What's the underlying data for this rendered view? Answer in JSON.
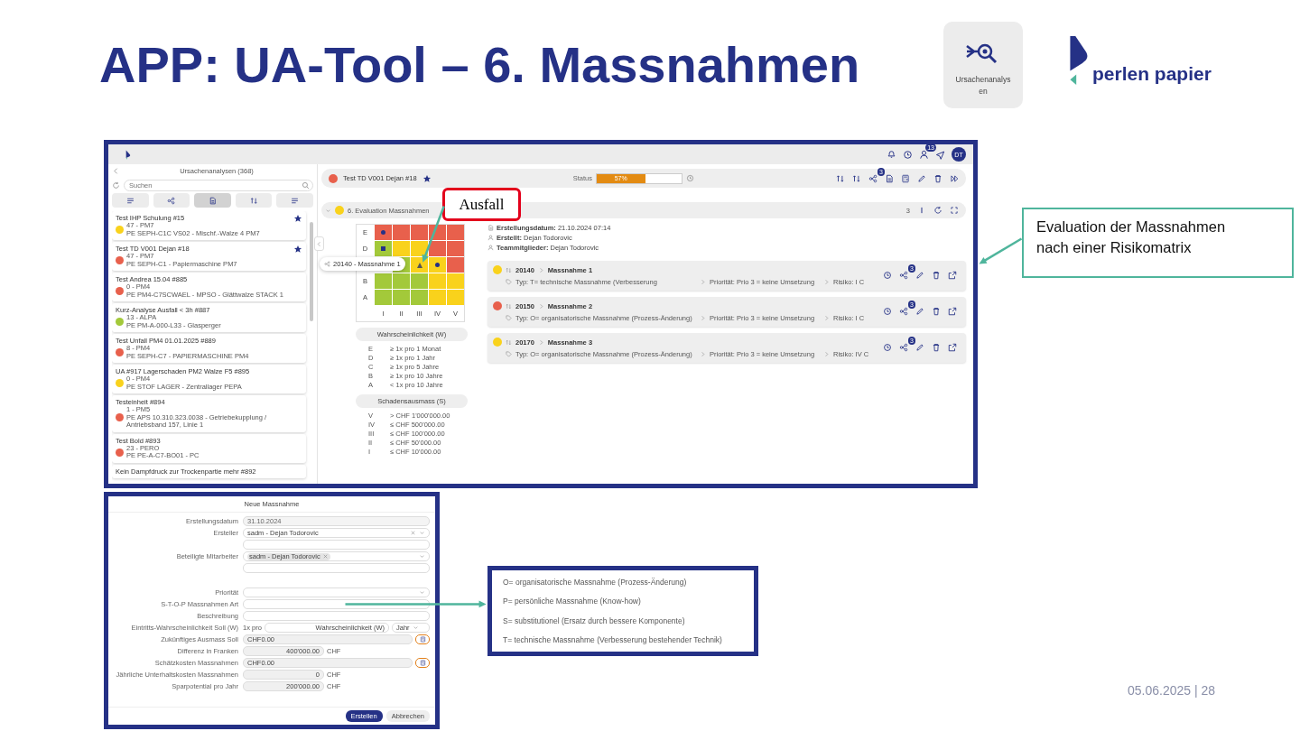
{
  "title": "APP: UA-Tool – 6. Massnahmen",
  "app_tile": {
    "label": "Ursachenanalysen"
  },
  "logo": {
    "text": "perlen papier"
  },
  "main_screenshot": {
    "top_bar": {
      "badge": "13",
      "avatar": "DT"
    },
    "list_panel": {
      "title": "Ursachenanalysen (368)",
      "search_placeholder": "Suchen",
      "filters": [
        {
          "selected": false
        },
        {
          "selected": false
        },
        {
          "selected": true
        },
        {
          "selected": false
        },
        {
          "selected": false
        }
      ],
      "items": [
        {
          "title": "Test IHP Schulung",
          "number": "#15",
          "location": "47 - PM7",
          "equipment": "PE SEPH-C1C VS02 - Mischf.-Walze 4 PM7",
          "color": "#f9d21c",
          "starred": true
        },
        {
          "title": "Test TD V001 Dejan",
          "number": "#18",
          "location": "47 - PM7",
          "equipment": "PE SEPH-C1 - Papiermaschine PM7",
          "color": "#e8604c",
          "starred": true
        },
        {
          "title": "Test Andrea 15.04",
          "number": "#885",
          "location": "0 - PM4",
          "equipment": "PE PM4-C7SCWAEL - MPSO - Glättwalze STACK 1",
          "color": "#e8604c",
          "starred": false
        },
        {
          "title": "Kurz-Analyse Ausfall < 3h",
          "number": "#887",
          "location": "13 - ALPA",
          "equipment": "PE PM-A-000-L33 - Glasperger",
          "color": "#a3c93a",
          "starred": false
        },
        {
          "title": "Test Unfall PM4 01.01.2025",
          "number": "#889",
          "location": "8 - PM4",
          "equipment": "PE SEPH-C7 - PAPIERMASCHINE PM4",
          "color": "#e8604c",
          "starred": false
        },
        {
          "title": "UA #917 Lagerschaden PM2 Walze F5",
          "number": "#895",
          "location": "0 - PM4",
          "equipment": "PE STOF LAGER - Zentrallager PEPA",
          "color": "#f9d21c",
          "starred": false
        },
        {
          "title": "Testeinheit",
          "number": "#894",
          "location": "1 - PM5",
          "equipment": "PE APS 10.310.323.0038 - Getriebekupplung / Antriebsband 157, Linie 1",
          "color": "#e8604c",
          "starred": false
        },
        {
          "title": "Test Bold",
          "number": "#893",
          "location": "23 - PERO",
          "equipment": "PE PE-A-C7-BO01 - PC",
          "color": "#e8604c",
          "starred": false
        },
        {
          "title": "Kein Dampfdruck zur Trockenpartie mehr",
          "number": "#892"
        }
      ]
    },
    "header": {
      "title": "Test TD V001 Dejan",
      "number": "#18",
      "color": "#e8604c",
      "starred": true,
      "status_label": "Status",
      "progress": {
        "level": 0.57,
        "text": "57%"
      },
      "badge": "3"
    },
    "section": {
      "title": "6. Evaluation Massnahmen",
      "color": "#f9d21c",
      "count": "3"
    },
    "matrix": {
      "column_labels": [
        "I",
        "II",
        "III",
        "IV",
        "V"
      ],
      "rows": [
        {
          "label": "E",
          "cells": [
            {
              "color": "#e8604c",
              "kind": "dot"
            },
            {
              "color": "#e8604c",
              "kind": "plain"
            },
            {
              "color": "#e8604c",
              "kind": "plain"
            },
            {
              "color": "#e8604c",
              "kind": "plain"
            },
            {
              "color": "#e8604c",
              "kind": "plain"
            }
          ]
        },
        {
          "label": "D",
          "cells": [
            {
              "color": "#a3c93a",
              "kind": "square"
            },
            {
              "color": "#f9d21c",
              "kind": "plain"
            },
            {
              "color": "#f9d21c",
              "kind": "plain"
            },
            {
              "color": "#e8604c",
              "kind": "plain"
            },
            {
              "color": "#e8604c",
              "kind": "plain"
            }
          ]
        },
        {
          "cells": [
            {
              "kind": "plain"
            },
            {
              "color": "#a3c93a",
              "kind": "plain"
            },
            {
              "color": "#f9d21c",
              "kind": "triangle"
            },
            {
              "color": "#f9d21c",
              "kind": "dot"
            },
            {
              "color": "#e8604c",
              "kind": "plain"
            }
          ]
        },
        {
          "label": "B",
          "cells": [
            {
              "color": "#a3c93a",
              "kind": "plain"
            },
            {
              "color": "#a3c93a",
              "kind": "plain"
            },
            {
              "color": "#a3c93a",
              "kind": "plain"
            },
            {
              "color": "#f9d21c",
              "kind": "plain"
            },
            {
              "color": "#f9d21c",
              "kind": "plain"
            }
          ]
        },
        {
          "label": "A",
          "cells": [
            {
              "color": "#a3c93a",
              "kind": "plain"
            },
            {
              "color": "#a3c93a",
              "kind": "plain"
            },
            {
              "color": "#a3c93a",
              "kind": "plain"
            },
            {
              "color": "#f9d21c",
              "kind": "plain"
            },
            {
              "color": "#f9d21c",
              "kind": "plain"
            }
          ]
        }
      ],
      "tooltip": "20140 - Massnahme 1"
    },
    "probability_legend": {
      "title": "Wahrscheinlichkeit (W)",
      "entries": [
        {
          "key": "E",
          "text": "≥ 1x pro 1 Monat"
        },
        {
          "key": "D",
          "text": "≥ 1x pro 1 Jahr"
        },
        {
          "key": "C",
          "text": "≥ 1x pro 5 Jahre"
        },
        {
          "key": "B",
          "text": "≥ 1x pro 10 Jahre"
        },
        {
          "key": "A",
          "text": "< 1x pro 10 Jahre"
        }
      ]
    },
    "damage_legend": {
      "title": "Schadensausmass (S)",
      "entries": [
        {
          "key": "V",
          "text": "> CHF 1'000'000.00"
        },
        {
          "key": "IV",
          "text": "≤ CHF 500'000.00"
        },
        {
          "key": "III",
          "text": "≤ CHF 100'000.00"
        },
        {
          "key": "II",
          "text": "≤ CHF 50'000.00"
        },
        {
          "key": "I",
          "text": "≤ CHF 10'000.00"
        }
      ]
    },
    "meta": [
      {
        "label": "Erstellungsdatum:",
        "value": "21.10.2024 07:14"
      },
      {
        "label": "Erstellt:",
        "value": "Dejan Todorovic"
      },
      {
        "label": "Teammitglieder:",
        "value": "Dejan Todorovic"
      }
    ],
    "measures": [
      {
        "id": "20140",
        "name": "Massnahme 1",
        "color": "#f9d21c",
        "type": "Typ: T= technische Massnahme (Verbesserung",
        "priority": "Priorität: Prio 3 = keine Umsetzung",
        "risk": "Risiko: I C",
        "badge": "3"
      },
      {
        "id": "20150",
        "name": "Massnahme 2",
        "color": "#e8604c",
        "type": "Typ: O= organisatorische Massnahme (Prozess-Änderung)",
        "priority": "Priorität: Prio 3 = keine Umsetzung",
        "risk": "Risiko: I C",
        "badge": "3"
      },
      {
        "id": "20170",
        "name": "Massnahme 3",
        "color": "#f9d21c",
        "type": "Typ: O= organisatorische Massnahme (Prozess-Änderung)",
        "priority": "Priorität: Prio 3 = keine Umsetzung",
        "risk": "Risiko: IV C",
        "badge": "3"
      }
    ]
  },
  "callout_failure": "Ausfall",
  "callout_text": "Evaluation der Massnahmen nach einer Risikomatrix",
  "form_screenshot": {
    "title": "Neue Massnahme",
    "rows": [
      {
        "kind": "text",
        "label": "Erstellungsdatum",
        "value": "31.10.2024",
        "disabled": true
      },
      {
        "kind": "select",
        "label": "Ersteller",
        "value": "sadm - Dejan Todorovic"
      },
      {
        "kind": "text"
      },
      {
        "kind": "chips",
        "label": "Beteiligte Mitarbeiter",
        "value": "sadm - Dejan Todorovic"
      },
      {
        "kind": "text"
      },
      {
        "kind": "spacer"
      },
      {
        "kind": "select",
        "label": "Priorität"
      },
      {
        "kind": "text",
        "label": "S-T-O-P Massnahmen Art"
      },
      {
        "kind": "text",
        "label": "Beschreibung"
      },
      {
        "kind": "triple",
        "label": "Eintritts-Wahrscheinlichkeit Soll (W)",
        "prefix": "1x pro",
        "value": "Wahrscheinlichkeit (W)",
        "unit": "Jahr"
      },
      {
        "kind": "calc",
        "label": "Zukünftiges Ausmass Soll",
        "value": "CHF0.00"
      },
      {
        "kind": "amount",
        "label": "Differenz in Franken",
        "value": "400'000.00",
        "unit": "CHF"
      },
      {
        "kind": "calc",
        "label": "Schätzkosten Massnahmen",
        "value": "CHF0.00"
      },
      {
        "kind": "amount",
        "label": "Jährliche Unterhaltskosten Massnahmen",
        "value": "0",
        "unit": "CHF"
      },
      {
        "kind": "amount",
        "label": "Sparpotential pro Jahr",
        "value": "200'000.00",
        "unit": "CHF"
      }
    ],
    "buttons": [
      {
        "label": "Erstellen",
        "primary": true
      },
      {
        "label": "Abbrechen",
        "primary": false
      }
    ]
  },
  "stop_legend": [
    "O= organisatorische Massnahme (Prozess-Änderung)",
    "P= persönliche Massnahme (Know-how)",
    "S= substitutionel (Ersatz durch bessere Komponente)",
    "T= technische Massnahme (Verbesserung bestehender Technik)"
  ],
  "footer": "05.06.2025 | 28"
}
